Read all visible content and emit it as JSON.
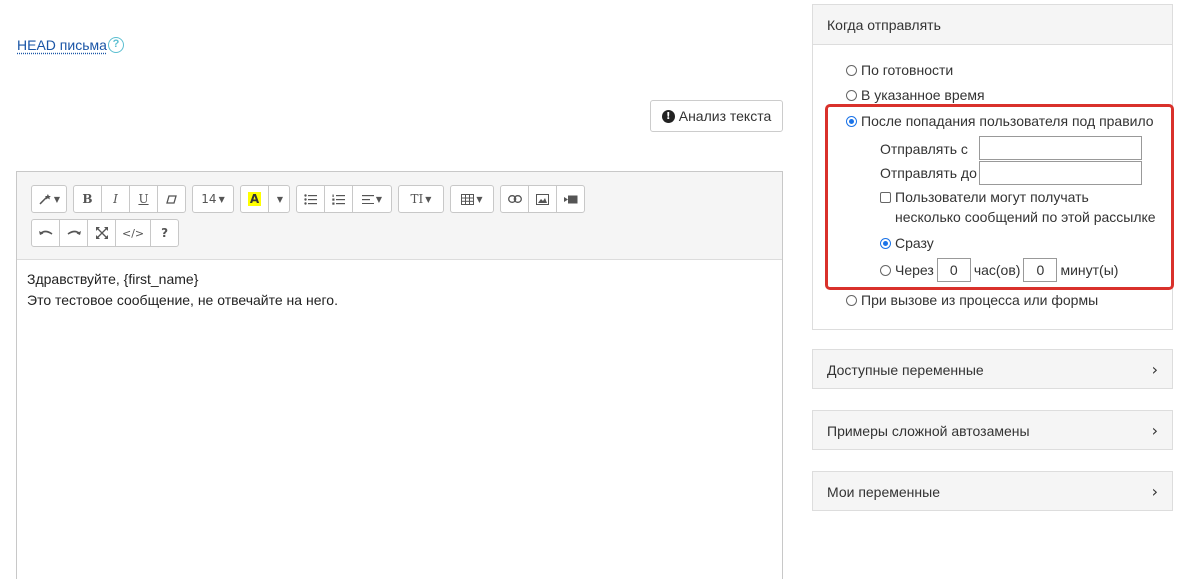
{
  "head_link": "HEAD письма",
  "help_icon": "?",
  "analyze_button": {
    "icon": "!",
    "label": "Анализ текста"
  },
  "toolbar": {
    "row1": [
      {
        "name": "magic-wand-icon",
        "glyph": "⁄✦",
        "caret": true
      },
      {
        "name": "bold-button",
        "glyph": "B"
      },
      {
        "name": "italic-button",
        "glyph": "I"
      },
      {
        "name": "underline-button",
        "glyph": "U"
      },
      {
        "name": "eraser-icon",
        "glyph": "▱"
      },
      {
        "name": "font-size-select",
        "glyph": "14",
        "caret": true
      },
      {
        "name": "highlight-color-button",
        "glyph": "A"
      },
      {
        "name": "color-dropdown",
        "glyph": "",
        "caret": true
      },
      {
        "name": "bullet-list-icon",
        "glyph": "☰"
      },
      {
        "name": "numbered-list-icon",
        "glyph": "☷"
      },
      {
        "name": "align-icon",
        "glyph": "≡",
        "caret": true
      },
      {
        "name": "text-style-icon",
        "glyph": "TI",
        "caret": true
      },
      {
        "name": "table-icon",
        "glyph": "▦",
        "caret": true
      },
      {
        "name": "link-icon",
        "glyph": "⊂⊃"
      },
      {
        "name": "image-icon",
        "glyph": "▣"
      },
      {
        "name": "video-icon",
        "glyph": "▶"
      }
    ],
    "row2": [
      {
        "name": "undo-icon",
        "glyph": "↶"
      },
      {
        "name": "redo-icon",
        "glyph": "↷"
      },
      {
        "name": "fullscreen-icon",
        "glyph": "⤧"
      },
      {
        "name": "code-view-icon",
        "glyph": "</>"
      },
      {
        "name": "help-icon",
        "glyph": "?"
      }
    ]
  },
  "editor_text": {
    "line1": "Здравствуйте, {first_name}",
    "line2": "Это тестовое сообщение, не отвечайте на него."
  },
  "when_panel": {
    "title": "Когда отправлять",
    "options": {
      "ready": "По готовности",
      "scheduled": "В указанное время",
      "rule": "После попадания пользователя под правило",
      "process": "При вызове из процесса или формы"
    },
    "send_from_label": "Отправлять с",
    "send_to_label": "Отправлять до",
    "multi_line1": "Пользователи могут получать",
    "multi_line2": "несколько сообщений по этой рассылке",
    "immediately": "Сразу",
    "after_label": "Через",
    "hours_value": "0",
    "hours_label": "час(ов)",
    "minutes_value": "0",
    "minutes_label": "минут(ы)"
  },
  "sections": {
    "vars": "Доступные переменные",
    "examples": "Примеры сложной автозамены",
    "my_vars": "Мои переменные"
  },
  "highlight_color": "#d9312b",
  "accent_color": "#1a73e8"
}
